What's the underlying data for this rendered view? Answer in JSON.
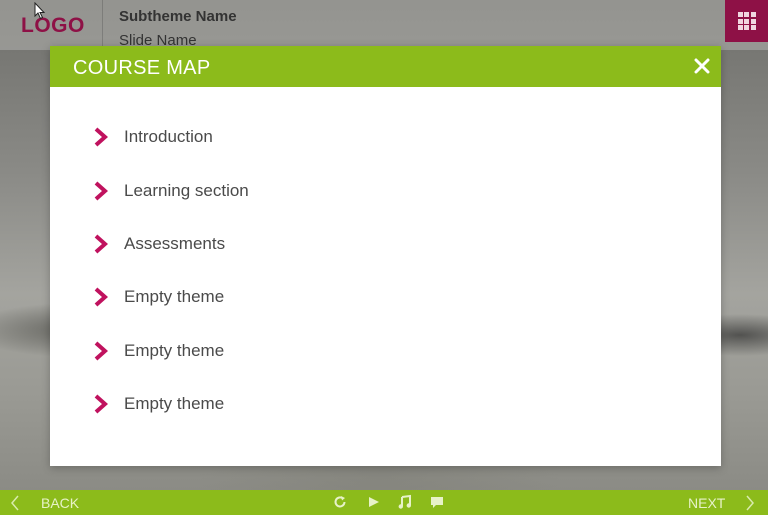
{
  "header": {
    "logo_text": "LOGO",
    "subtheme_name": "Subtheme Name",
    "slide_name": "Slide Name"
  },
  "course_map": {
    "title": "COURSE MAP",
    "items": [
      {
        "label": "Introduction"
      },
      {
        "label": "Learning section"
      },
      {
        "label": "Assessments"
      },
      {
        "label": "Empty theme"
      },
      {
        "label": "Empty theme"
      },
      {
        "label": "Empty theme"
      }
    ]
  },
  "footer": {
    "back_label": "BACK",
    "next_label": "NEXT",
    "controls": [
      "replay-icon",
      "play-icon",
      "music-icon",
      "comment-icon"
    ]
  },
  "colors": {
    "accent_green": "#8cbb1b",
    "brand_magenta": "#8e1146",
    "chevron": "#c0125e"
  },
  "icons": {
    "menu": "grid-icon",
    "close": "close-icon",
    "bullet": "chevron-right-icon"
  }
}
